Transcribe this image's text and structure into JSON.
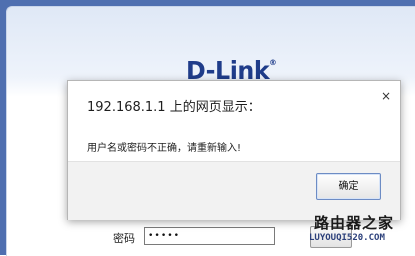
{
  "login_page": {
    "brand_logo": "D-Link",
    "brand_reg_mark": "®",
    "password_label": "密码",
    "password_value": "•••••"
  },
  "dialog": {
    "title": "192.168.1.1 上的网页显示：",
    "close_glyph": "×",
    "message": "用户名或密码不正确，请重新输入!",
    "ok_label": "确定"
  },
  "watermark": {
    "name": "路由器之家",
    "url": "LUYOUQI520.COM"
  }
}
